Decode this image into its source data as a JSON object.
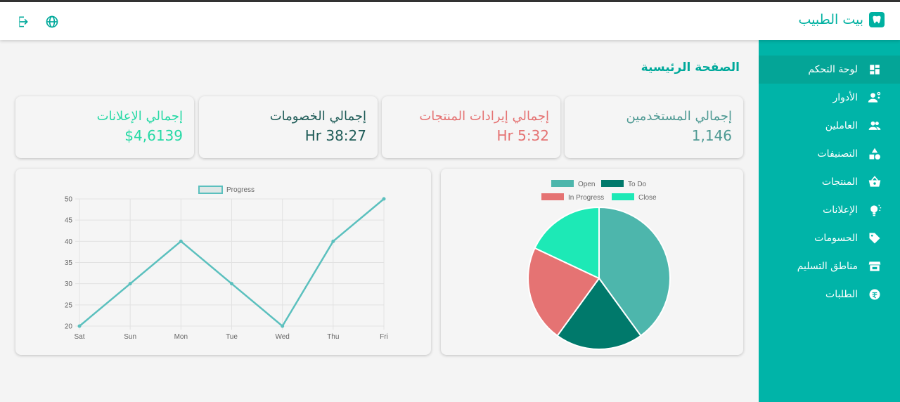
{
  "brand": {
    "name": "بيت الطبيب"
  },
  "page": {
    "title": "الصفحة الرئيسية"
  },
  "sidebar": {
    "items": [
      {
        "label": "لوحة التحكم",
        "icon": "dashboard-icon",
        "active": true
      },
      {
        "label": "الأدوار",
        "icon": "roles-icon"
      },
      {
        "label": "العاملين",
        "icon": "employees-icon"
      },
      {
        "label": "التصنيفات",
        "icon": "categories-icon"
      },
      {
        "label": "المنتجات",
        "icon": "basket-icon"
      },
      {
        "label": "الإعلانات",
        "icon": "lightbulb-icon"
      },
      {
        "label": "الحسومات",
        "icon": "tag-icon"
      },
      {
        "label": "مناطق التسليم",
        "icon": "store-icon"
      },
      {
        "label": "الطلبات",
        "icon": "orders-icon"
      }
    ]
  },
  "stats": [
    {
      "label": "إجمالي المستخدمين",
      "value": "1,146",
      "color": "#4f9a94"
    },
    {
      "label": "إجمالي إيرادات المنتجات",
      "value": "Hr 5:32",
      "color": "#e57373"
    },
    {
      "label": "إجمالي الخصومات",
      "value": "Hr 38:27",
      "color": "#1f5c58"
    },
    {
      "label": "إجمالي الإعلانات",
      "value": "$4,6139",
      "color": "#26d9a5"
    }
  ],
  "chart_data": [
    {
      "type": "pie",
      "legend_position": "top",
      "series": [
        {
          "name": "Open",
          "value": 40,
          "color": "#4db6ac"
        },
        {
          "name": "To Do",
          "value": 20,
          "color": "#00796b"
        },
        {
          "name": "In Progress",
          "value": 22,
          "color": "#e57373"
        },
        {
          "name": "Close",
          "value": 18,
          "color": "#1de9b6"
        }
      ]
    },
    {
      "type": "line",
      "legend_position": "top",
      "categories": [
        "Sat",
        "Sun",
        "Mon",
        "Tue",
        "Wed",
        "Thu",
        "Fri"
      ],
      "series": [
        {
          "name": "Progress",
          "values": [
            20,
            30,
            40,
            30,
            20,
            40,
            50
          ],
          "color": "#5bc0be"
        }
      ],
      "ylim": [
        20,
        50
      ],
      "yticks": [
        20,
        25,
        30,
        35,
        40,
        45,
        50
      ],
      "grid": true
    }
  ]
}
